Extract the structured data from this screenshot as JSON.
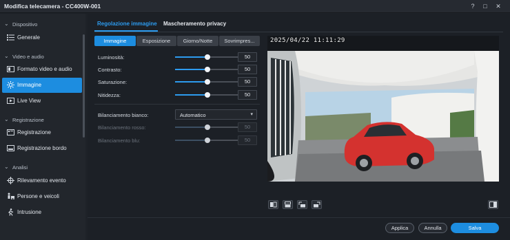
{
  "window": {
    "title": "Modifica telecamera - CC400W-001",
    "help_label": "?",
    "maximize_label": "□",
    "close_label": "✕"
  },
  "sidebar": {
    "sections": [
      {
        "label": "Dispositivo",
        "items": [
          {
            "label": "Generale",
            "icon": "list-icon",
            "active": false
          }
        ]
      },
      {
        "label": "Video e audio",
        "items": [
          {
            "label": "Formato video e audio",
            "icon": "video-format-icon",
            "active": false
          },
          {
            "label": "Immagine",
            "icon": "brightness-icon",
            "active": true
          },
          {
            "label": "Live View",
            "icon": "live-view-icon",
            "active": false
          }
        ]
      },
      {
        "label": "Registrazione",
        "items": [
          {
            "label": "Registrazione",
            "icon": "recording-icon",
            "active": false
          },
          {
            "label": "Registrazione bordo",
            "icon": "edge-recording-icon",
            "active": false
          }
        ]
      },
      {
        "label": "Analisi",
        "items": [
          {
            "label": "Rilevamento evento",
            "icon": "event-detection-icon",
            "active": false
          },
          {
            "label": "Persone e veicoli",
            "icon": "people-vehicles-icon",
            "active": false
          },
          {
            "label": "Intrusione",
            "icon": "intrusion-icon",
            "active": false
          }
        ]
      }
    ]
  },
  "tabs": [
    {
      "label": "Regolazione immagine",
      "active": true
    },
    {
      "label": "Mascheramento privacy",
      "active": false
    }
  ],
  "subtabs": [
    {
      "label": "Immagine",
      "active": true
    },
    {
      "label": "Esposizione",
      "active": false
    },
    {
      "label": "Giorno/Notte",
      "active": false
    },
    {
      "label": "Sovrimpres...",
      "active": false
    }
  ],
  "adjustments": [
    {
      "label": "Luminosità:",
      "value": "50",
      "level_pct": 50,
      "enabled": true
    },
    {
      "label": "Contrasto:",
      "value": "50",
      "level_pct": 50,
      "enabled": true
    },
    {
      "label": "Saturazione:",
      "value": "50",
      "level_pct": 50,
      "enabled": true
    },
    {
      "label": "Nitidezza:",
      "value": "50",
      "level_pct": 50,
      "enabled": true
    }
  ],
  "white_balance": {
    "label": "Bilanciamento bianco:",
    "value": "Automatico",
    "red": {
      "label": "Bilanciamento rosso:",
      "value": "50",
      "level_pct": 50,
      "enabled": false
    },
    "blue": {
      "label": "Bilanciamento blu:",
      "value": "50",
      "level_pct": 50,
      "enabled": false
    }
  },
  "preview": {
    "timestamp": "2025/04/22 11:11:29"
  },
  "preview_controls": [
    {
      "icon": "flip-vertical-icon"
    },
    {
      "icon": "flip-horizontal-icon"
    },
    {
      "icon": "rotate-left-icon"
    },
    {
      "icon": "rotate-right-icon"
    },
    {
      "icon": "compare-view-icon"
    }
  ],
  "buttons": {
    "apply": "Applica",
    "cancel": "Annulla",
    "save": "Salva"
  },
  "colors": {
    "accent": "#1d8de0",
    "active_tab": "#2d9cf0"
  }
}
